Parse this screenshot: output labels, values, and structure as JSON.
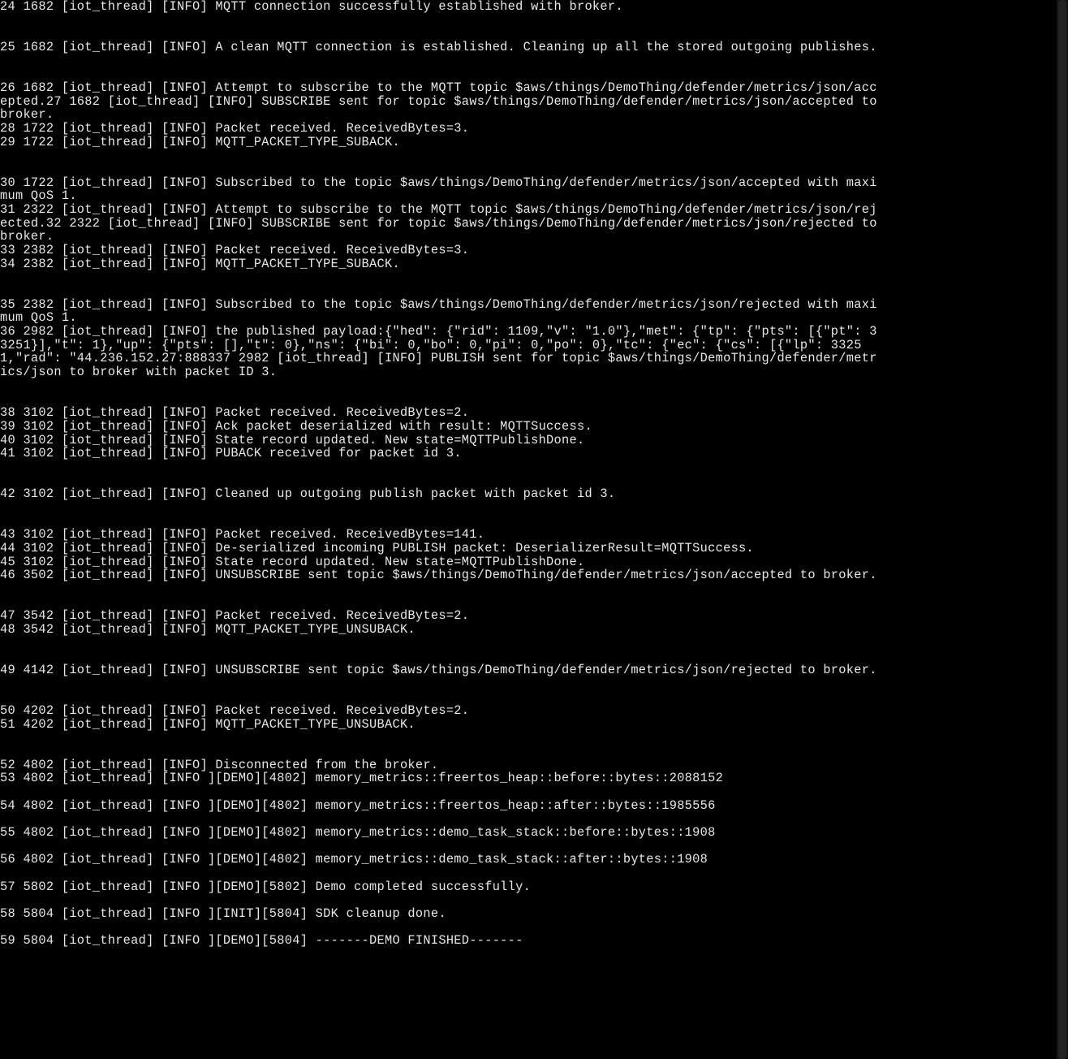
{
  "log": {
    "lines": [
      "24 1682 [iot_thread] [INFO] MQTT connection successfully established with broker.",
      "",
      "",
      "25 1682 [iot_thread] [INFO] A clean MQTT connection is established. Cleaning up all the stored outgoing publishes.",
      "",
      "",
      "26 1682 [iot_thread] [INFO] Attempt to subscribe to the MQTT topic $aws/things/DemoThing/defender/metrics/json/accepted.27 1682 [iot_thread] [INFO] SUBSCRIBE sent for topic $aws/things/DemoThing/defender/metrics/json/accepted to broker.",
      "28 1722 [iot_thread] [INFO] Packet received. ReceivedBytes=3.",
      "29 1722 [iot_thread] [INFO] MQTT_PACKET_TYPE_SUBACK.",
      "",
      "",
      "30 1722 [iot_thread] [INFO] Subscribed to the topic $aws/things/DemoThing/defender/metrics/json/accepted with maximum QoS 1.",
      "31 2322 [iot_thread] [INFO] Attempt to subscribe to the MQTT topic $aws/things/DemoThing/defender/metrics/json/rejected.32 2322 [iot_thread] [INFO] SUBSCRIBE sent for topic $aws/things/DemoThing/defender/metrics/json/rejected to broker.",
      "33 2382 [iot_thread] [INFO] Packet received. ReceivedBytes=3.",
      "34 2382 [iot_thread] [INFO] MQTT_PACKET_TYPE_SUBACK.",
      "",
      "",
      "35 2382 [iot_thread] [INFO] Subscribed to the topic $aws/things/DemoThing/defender/metrics/json/rejected with maximum QoS 1.",
      "36 2982 [iot_thread] [INFO] the published payload:{\"hed\": {\"rid\": 1109,\"v\": \"1.0\"},\"met\": {\"tp\": {\"pts\": [{\"pt\": 33251}],\"t\": 1},\"up\": {\"pts\": [],\"t\": 0},\"ns\": {\"bi\": 0,\"bo\": 0,\"pi\": 0,\"po\": 0},\"tc\": {\"ec\": {\"cs\": [{\"lp\": 33251,\"rad\": \"44.236.152.27:888337 2982 [iot_thread] [INFO] PUBLISH sent for topic $aws/things/DemoThing/defender/metrics/json to broker with packet ID 3.",
      "",
      "",
      "38 3102 [iot_thread] [INFO] Packet received. ReceivedBytes=2.",
      "39 3102 [iot_thread] [INFO] Ack packet deserialized with result: MQTTSuccess.",
      "40 3102 [iot_thread] [INFO] State record updated. New state=MQTTPublishDone.",
      "41 3102 [iot_thread] [INFO] PUBACK received for packet id 3.",
      "",
      "",
      "42 3102 [iot_thread] [INFO] Cleaned up outgoing publish packet with packet id 3.",
      "",
      "",
      "43 3102 [iot_thread] [INFO] Packet received. ReceivedBytes=141.",
      "44 3102 [iot_thread] [INFO] De-serialized incoming PUBLISH packet: DeserializerResult=MQTTSuccess.",
      "45 3102 [iot_thread] [INFO] State record updated. New state=MQTTPublishDone.",
      "46 3502 [iot_thread] [INFO] UNSUBSCRIBE sent topic $aws/things/DemoThing/defender/metrics/json/accepted to broker.",
      "",
      "",
      "47 3542 [iot_thread] [INFO] Packet received. ReceivedBytes=2.",
      "48 3542 [iot_thread] [INFO] MQTT_PACKET_TYPE_UNSUBACK.",
      "",
      "",
      "49 4142 [iot_thread] [INFO] UNSUBSCRIBE sent topic $aws/things/DemoThing/defender/metrics/json/rejected to broker.",
      "",
      "",
      "50 4202 [iot_thread] [INFO] Packet received. ReceivedBytes=2.",
      "51 4202 [iot_thread] [INFO] MQTT_PACKET_TYPE_UNSUBACK.",
      "",
      "",
      "52 4802 [iot_thread] [INFO] Disconnected from the broker.",
      "53 4802 [iot_thread] [INFO ][DEMO][4802] memory_metrics::freertos_heap::before::bytes::2088152",
      "",
      "54 4802 [iot_thread] [INFO ][DEMO][4802] memory_metrics::freertos_heap::after::bytes::1985556",
      "",
      "55 4802 [iot_thread] [INFO ][DEMO][4802] memory_metrics::demo_task_stack::before::bytes::1908",
      "",
      "56 4802 [iot_thread] [INFO ][DEMO][4802] memory_metrics::demo_task_stack::after::bytes::1908",
      "",
      "57 5802 [iot_thread] [INFO ][DEMO][5802] Demo completed successfully.",
      "",
      "58 5804 [iot_thread] [INFO ][INIT][5804] SDK cleanup done.",
      "",
      "59 5804 [iot_thread] [INFO ][DEMO][5804] -------DEMO FINISHED-------"
    ]
  }
}
